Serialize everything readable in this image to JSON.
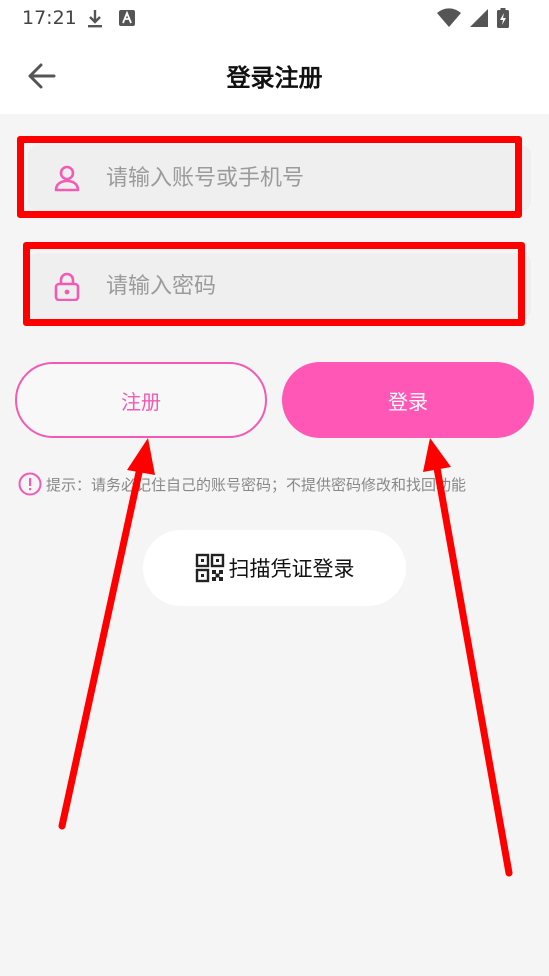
{
  "status_bar": {
    "time": "17:21"
  },
  "header": {
    "title": "登录注册"
  },
  "form": {
    "account_placeholder": "请输入账号或手机号",
    "password_placeholder": "请输入密码"
  },
  "buttons": {
    "register_label": "注册",
    "login_label": "登录"
  },
  "tip": {
    "text": "提示：请务必记住自己的账号密码；不提供密码修改和找回功能"
  },
  "scan": {
    "label": "扫描凭证登录"
  },
  "colors": {
    "accent": "#ff57b5",
    "annotation": "#ff0000"
  }
}
